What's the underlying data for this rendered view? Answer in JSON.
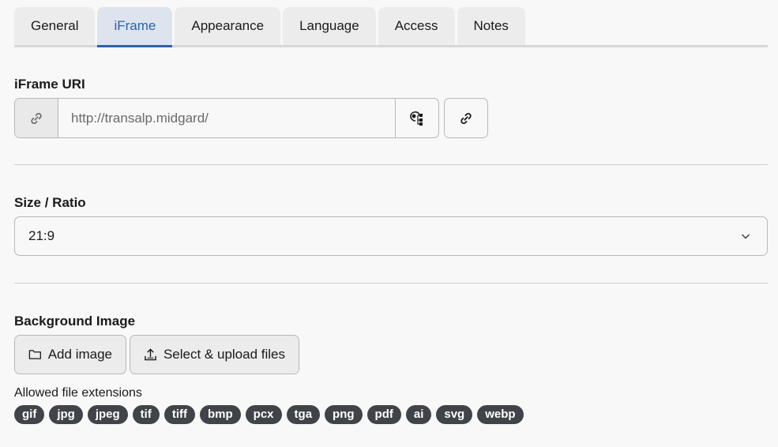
{
  "tabs": [
    {
      "label": "General",
      "active": false
    },
    {
      "label": "iFrame",
      "active": true
    },
    {
      "label": "Appearance",
      "active": false
    },
    {
      "label": "Language",
      "active": false
    },
    {
      "label": "Access",
      "active": false
    },
    {
      "label": "Notes",
      "active": false
    }
  ],
  "iframe_uri": {
    "label": "iFrame URI",
    "value": "http://transalp.midgard/",
    "addon_icon": "link-icon",
    "browse_icon": "page-tree-icon",
    "link_button_icon": "link-icon"
  },
  "size_ratio": {
    "label": "Size / Ratio",
    "selected": "21:9",
    "chevron_icon": "chevron-down-icon"
  },
  "background_image": {
    "label": "Background Image",
    "add_image_label": "Add image",
    "add_image_icon": "folder-icon",
    "upload_label": "Select & upload files",
    "upload_icon": "upload-icon",
    "allowed_label": "Allowed file extensions",
    "extensions": [
      "gif",
      "jpg",
      "jpeg",
      "tif",
      "tiff",
      "bmp",
      "pcx",
      "tga",
      "png",
      "pdf",
      "ai",
      "svg",
      "webp"
    ]
  },
  "colors": {
    "active_tab_text": "#2a64ab",
    "active_tab_underline": "#2c61a8",
    "badge_background": "#404448"
  }
}
